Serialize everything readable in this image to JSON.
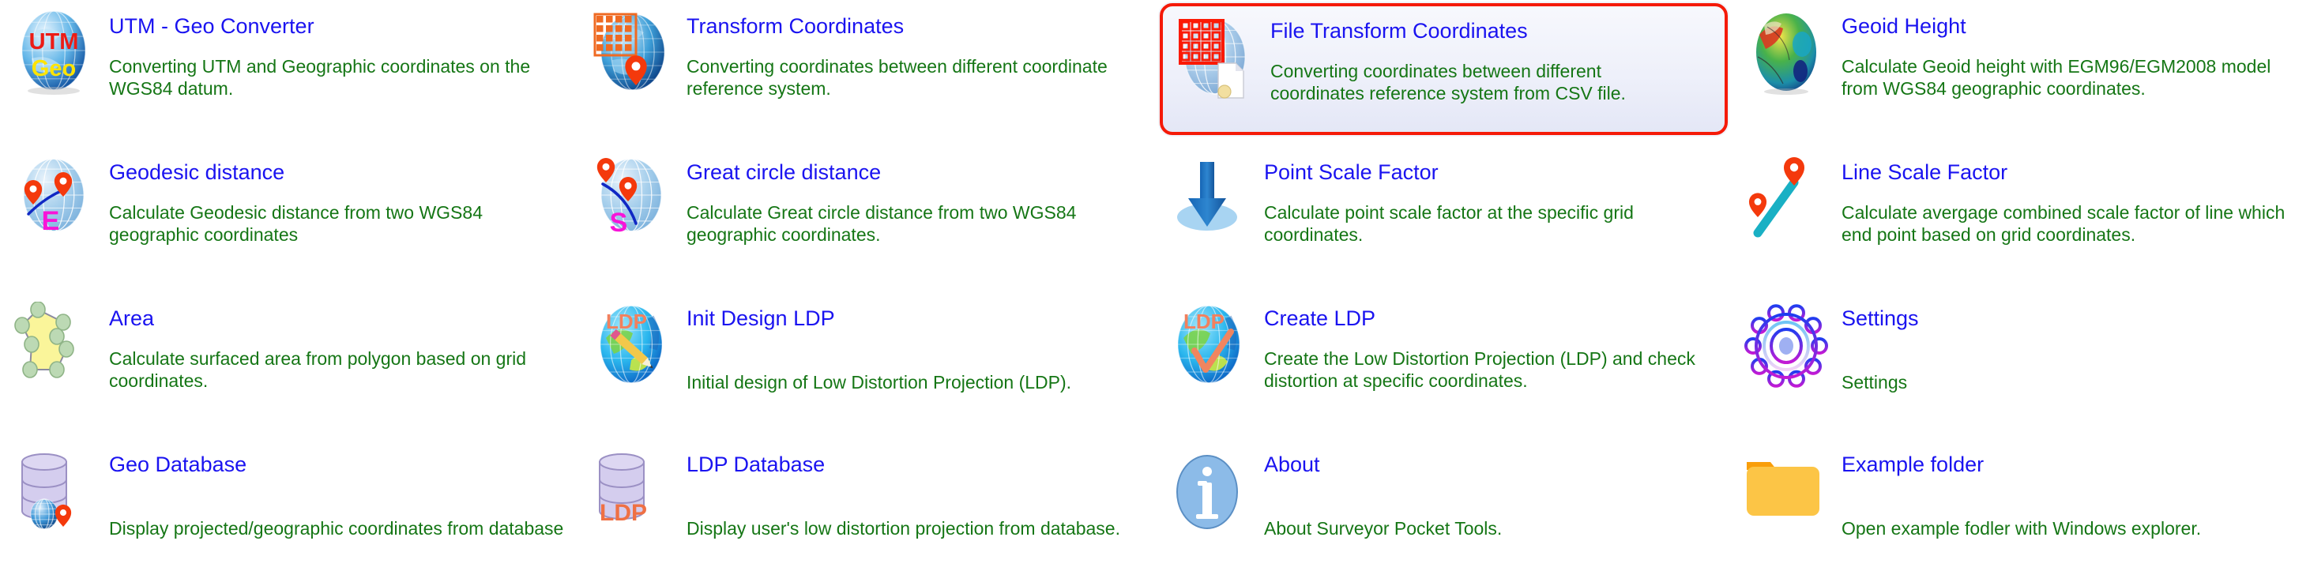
{
  "app": {
    "name": "Surveyor Pocket Tools",
    "accent_title_color": "#1a13f0",
    "accent_desc_color": "#157615",
    "selection_border_color": "#f51a08",
    "background_color": "#ffffff"
  },
  "tools": [
    {
      "id": "utm-geo-converter",
      "title": "UTM - Geo Converter",
      "description": "Converting UTM and Geographic coordinates on the\nWGS84 datum.",
      "icon": "utm-geo-globe-icon",
      "selected": false,
      "desc_low": false,
      "desc_clipped": false
    },
    {
      "id": "transform-coordinates",
      "title": "Transform Coordinates",
      "description": "Converting coordinates between different coordinate\nreference system.",
      "icon": "grid-globe-pin-icon",
      "selected": false,
      "desc_low": false,
      "desc_clipped": false
    },
    {
      "id": "file-transform-coordinates",
      "title": "File Transform Coordinates",
      "description": "Converting coordinates between different\ncoordinates reference system from CSV file.",
      "icon": "grid-globe-file-icon",
      "selected": true,
      "desc_low": false,
      "desc_clipped": false
    },
    {
      "id": "geoid-height",
      "title": "Geoid Height",
      "description": "Calculate Geoid height with EGM96/EGM2008 model\nfrom WGS84 geographic coordinates.",
      "icon": "geoid-globe-icon",
      "selected": false,
      "desc_low": false,
      "desc_clipped": false
    },
    {
      "id": "geodesic-distance",
      "title": "Geodesic distance",
      "description": "Calculate Geodesic distance from two WGS84\ngeographic coordinates",
      "icon": "geodesic-globe-icon",
      "selected": false,
      "desc_low": false,
      "desc_clipped": false
    },
    {
      "id": "great-circle-distance",
      "title": "Great circle distance",
      "description": "Calculate Great circle distance from two WGS84\ngeographic coordinates.",
      "icon": "great-circle-globe-icon",
      "selected": false,
      "desc_low": false,
      "desc_clipped": false
    },
    {
      "id": "point-scale-factor",
      "title": "Point Scale Factor",
      "description": "Calculate point scale factor at the specific grid\ncoordinates.",
      "icon": "down-arrow-ellipse-icon",
      "selected": false,
      "desc_low": false,
      "desc_clipped": false
    },
    {
      "id": "line-scale-factor",
      "title": "Line Scale Factor",
      "description": "Calculate avergage combined scale factor of line which\nend point based on grid coordinates.",
      "icon": "two-pins-line-icon",
      "selected": false,
      "desc_low": false,
      "desc_clipped": false
    },
    {
      "id": "area",
      "title": "Area",
      "description": "Calculate surfaced area from polygon based on grid\ncoordinates.",
      "icon": "polygon-area-icon",
      "selected": false,
      "desc_low": false,
      "desc_clipped": false
    },
    {
      "id": "init-design-ldp",
      "title": "Init Design LDP",
      "description": "Initial design of Low Distortion Projection (LDP).",
      "icon": "ldp-pencil-globe-icon",
      "selected": false,
      "desc_low": true,
      "desc_clipped": false
    },
    {
      "id": "create-ldp",
      "title": "Create LDP",
      "description": "Create the Low Distortion Projection (LDP) and check\ndistortion at specific coordinates.",
      "icon": "ldp-check-globe-icon",
      "selected": false,
      "desc_low": false,
      "desc_clipped": false
    },
    {
      "id": "settings",
      "title": "Settings",
      "description": "Settings",
      "icon": "gear-icon",
      "selected": false,
      "desc_low": true,
      "desc_clipped": false
    },
    {
      "id": "geo-database",
      "title": "Geo Database",
      "description": "Display projected/geographic coordinates from database",
      "icon": "database-globe-pin-icon",
      "selected": false,
      "desc_low": true,
      "desc_clipped": true
    },
    {
      "id": "ldp-database",
      "title": "LDP Database",
      "description": "Display user's low distortion projection from database.",
      "icon": "database-ldp-icon",
      "selected": false,
      "desc_low": true,
      "desc_clipped": false
    },
    {
      "id": "about",
      "title": "About",
      "description": "About Surveyor Pocket Tools.",
      "icon": "info-circle-icon",
      "selected": false,
      "desc_low": true,
      "desc_clipped": false
    },
    {
      "id": "example-folder",
      "title": "Example folder",
      "description": "Open example fodler with Windows explorer.",
      "icon": "folder-icon",
      "selected": false,
      "desc_low": true,
      "desc_clipped": false
    }
  ]
}
